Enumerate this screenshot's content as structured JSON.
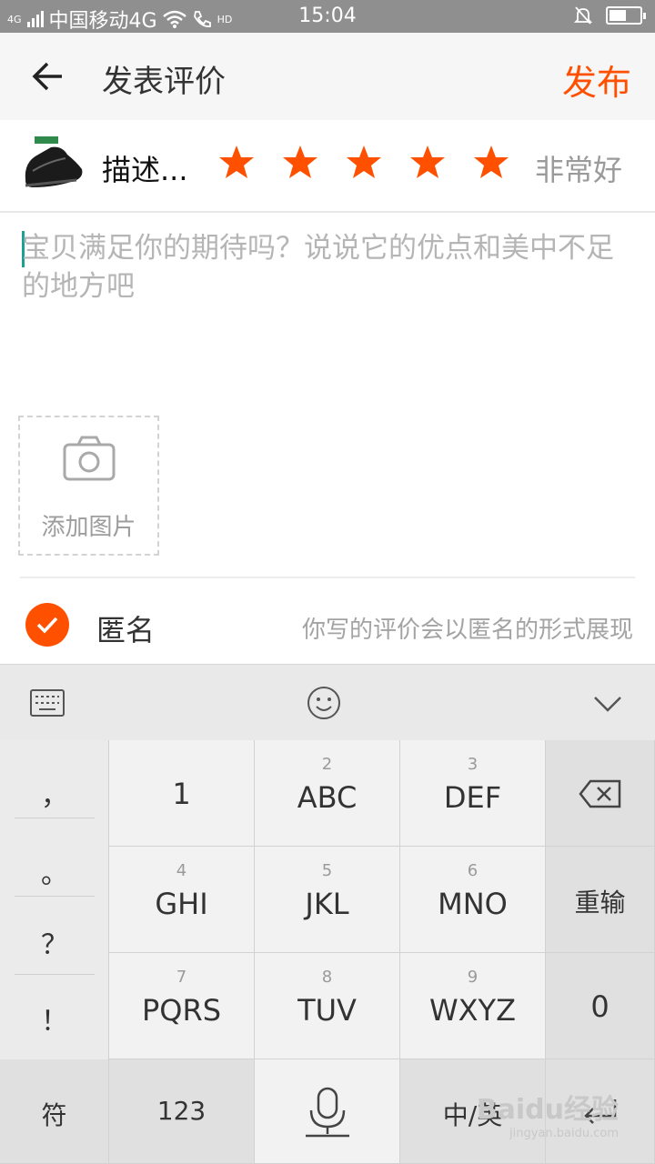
{
  "status_bar": {
    "carrier": "中国移动4G",
    "network_small": "4G",
    "hd": "HD",
    "time": "15:04",
    "battery_level": 0.55
  },
  "header": {
    "title": "发表评价",
    "publish_label": "发布"
  },
  "product": {
    "desc_label": "描述...",
    "stars_filled": 5,
    "stars_total": 5,
    "rating_text": "非常好",
    "star_color": "#ff5000"
  },
  "review": {
    "placeholder": "宝贝满足你的期待吗？说说它的优点和美中不足的地方吧"
  },
  "photo": {
    "add_label": "添加图片"
  },
  "anonymous": {
    "label": "匿名",
    "hint": "你写的评价会以匿名的形式展现",
    "checked": true
  },
  "keyboard": {
    "symbols": [
      "，",
      "。",
      "？",
      "！"
    ],
    "keys": [
      {
        "num": "",
        "label": "1"
      },
      {
        "num": "2",
        "label": "ABC"
      },
      {
        "num": "3",
        "label": "DEF"
      },
      {
        "num": "4",
        "label": "GHI"
      },
      {
        "num": "5",
        "label": "JKL"
      },
      {
        "num": "6",
        "label": "MNO"
      },
      {
        "num": "7",
        "label": "PQRS"
      },
      {
        "num": "8",
        "label": "TUV"
      },
      {
        "num": "9",
        "label": "WXYZ"
      }
    ],
    "reenter_label": "重输",
    "zero_label": "0",
    "symbol_key_label": "符",
    "num_key_label": "123",
    "lang_key_label": "中/英",
    "accent_color": "#ff5000"
  },
  "watermark": {
    "brand": "Baidu经验",
    "url": "jingyan.baidu.com"
  }
}
